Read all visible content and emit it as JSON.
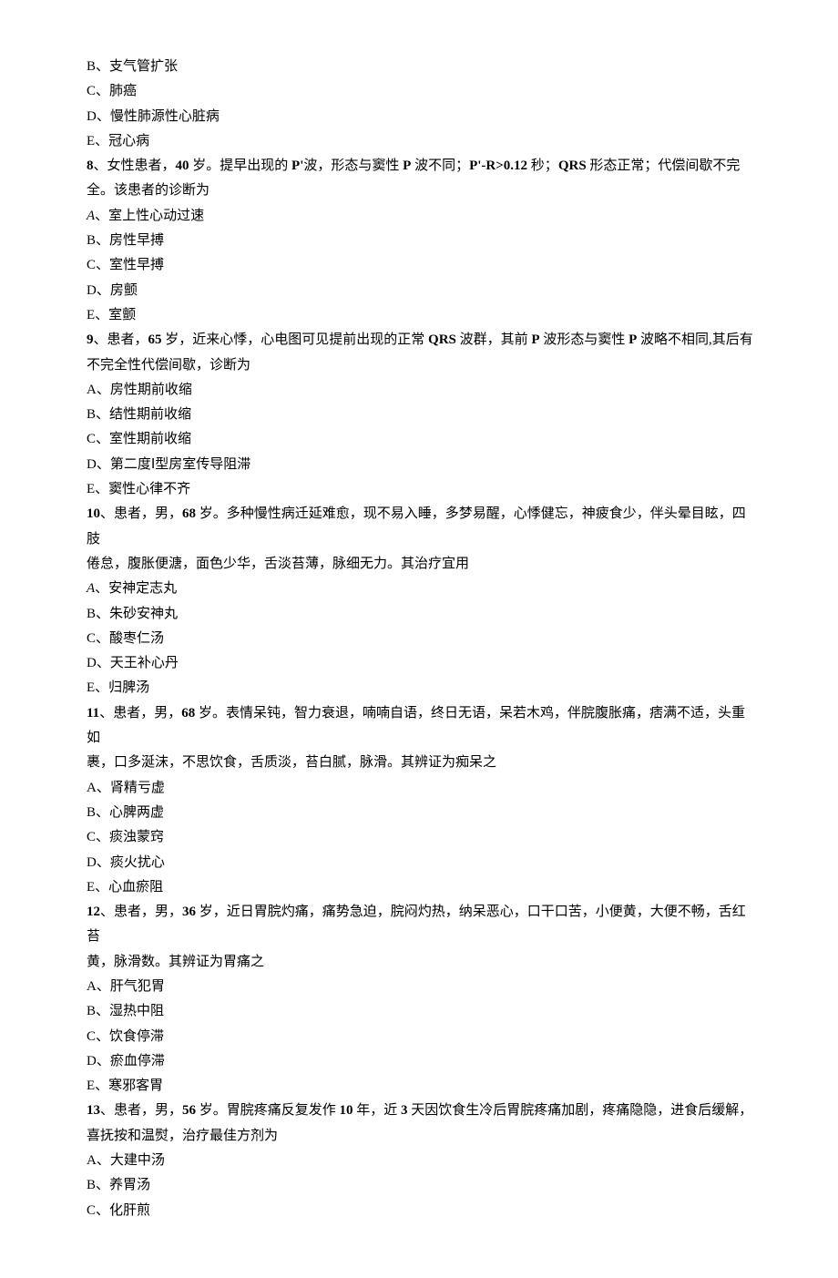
{
  "lines": {
    "q7bB": "B、支气管扩张",
    "q7bC": "C、肺癌",
    "q7bD": "D、慢性肺源性心脏病",
    "q7bE": "E、冠心病",
    "q8num": "8",
    "q8mid": "、女性患者，",
    "q8age": "40",
    "q8a": " 岁。提早出现的 ",
    "q8b": "P'",
    "q8c": "波，形态与窦性 ",
    "q8d": "P",
    "q8e": " 波不同；",
    "q8f": "P'-R>0.12",
    "q8g": " 秒；",
    "q8h": "QRS",
    "q8i": " 形态正常；代偿间歇不完",
    "q8line2": "全。该患者的诊断为",
    "q8A_prefix": "A",
    "q8A_rest": "、室上性心动过速",
    "q8B": "B、房性早搏",
    "q8C": "C、室性早搏",
    "q8D": "D、房颤",
    "q8E": "E、室颤",
    "q9num": "9",
    "q9a": "、患者，",
    "q9age": "65",
    "q9b": " 岁，近来心悸，心电图可见提前出现的正常 ",
    "q9c": "QRS",
    "q9d": " 波群，其前 ",
    "q9e": "P",
    "q9f": " 波形态与窦性 ",
    "q9g": "P",
    "q9h": " 波略不相同,其后有",
    "q9line2": "不完全性代偿间歇，诊断为",
    "q9A": "A、房性期前收缩",
    "q9B": "B、结性期前收缩",
    "q9C": "C、室性期前收缩",
    "q9D": "D、第二度Ⅰ型房室传导阻滞",
    "q9E": "E、窦性心律不齐",
    "q10num": "10",
    "q10a": "、患者，男，",
    "q10age": "68",
    "q10b": " 岁。多种慢性病迁延难愈，现不易入睡，多梦易醒，心悸健忘，神疲食少，伴头晕目眩，四肢",
    "q10line2": "倦怠，腹胀便溏，面色少华，舌淡苔薄，脉细无力。其治疗宜用",
    "q10A_prefix": "A",
    "q10A_rest": "、安神定志丸",
    "q10B": "B、朱砂安神丸",
    "q10C": "C、酸枣仁汤",
    "q10D": "D、天王补心丹",
    "q10E": "E、归脾汤",
    "q11num": "11",
    "q11a": "、患者，男，",
    "q11age": "68",
    "q11b": " 岁。表情呆钝，智力衰退，喃喃自语，终日无语，呆若木鸡，伴脘腹胀痛，痞满不适，头重如",
    "q11line2": "裹，口多涎沫，不思饮食，舌质淡，苔白腻，脉滑。其辨证为痴呆之",
    "q11A": "A、肾精亏虚",
    "q11B": "B、心脾两虚",
    "q11C": "C、痰浊蒙窍",
    "q11D": "D、痰火扰心",
    "q11E": "E、心血瘀阻",
    "q12num": "12",
    "q12a": "、患者，男，",
    "q12age": "36",
    "q12b": " 岁，近日胃脘灼痛，痛势急迫，脘闷灼热，纳呆恶心，口干口苦，小便黄，大便不畅，舌红苔",
    "q12line2": "黄，脉滑数。其辨证为胃痛之",
    "q12A": "A、肝气犯胃",
    "q12B": "B、湿热中阻",
    "q12C": "C、饮食停滞",
    "q12D": "D、瘀血停滞",
    "q12E": "E、寒邪客胃",
    "q13num": "13",
    "q13a": "、患者，男，",
    "q13age": "56",
    "q13b": " 岁。胃脘疼痛反复发作 ",
    "q13c": "10",
    "q13d": " 年，近 ",
    "q13e": "3",
    "q13f": " 天因饮食生冷后胃脘疼痛加剧，疼痛隐隐，进食后缓解，",
    "q13line2": "喜抚按和温熨，治疗最佳方剂为",
    "q13A": "A、大建中汤",
    "q13B": "B、养胃汤",
    "q13C": "C、化肝煎"
  }
}
